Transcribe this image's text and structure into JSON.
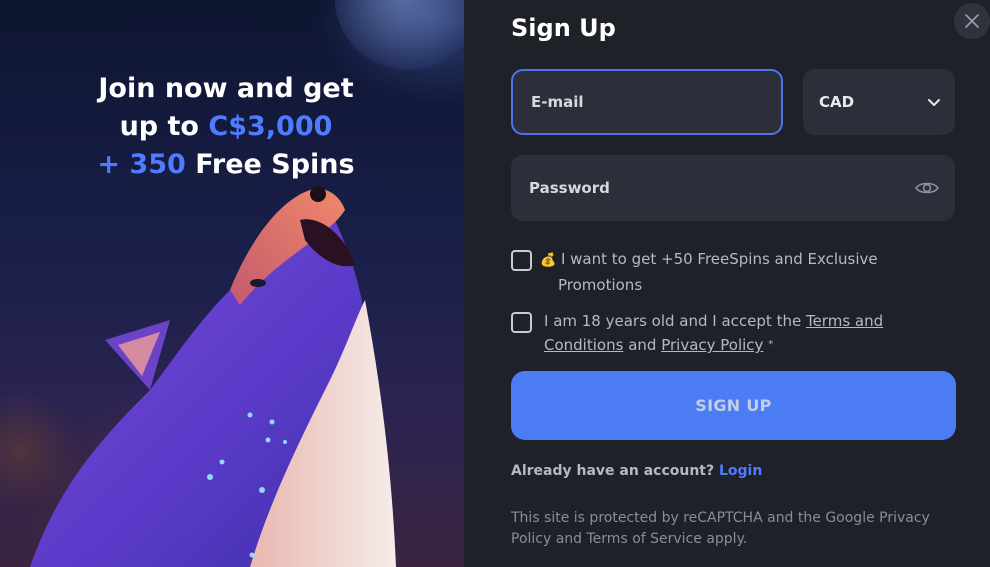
{
  "promo": {
    "headline_line1": "Join now and get",
    "headline_up_to": "up to",
    "headline_amount": "C$3,000",
    "headline_plus_spins": "+ 350",
    "headline_free_spins": "Free Spins",
    "accent_color": "#4f7bff"
  },
  "form": {
    "title": "Sign Up",
    "email_placeholder": "E-mail",
    "currency_value": "CAD",
    "password_placeholder": "Password",
    "promo_checkbox_emoji": "💰",
    "promo_checkbox_line1": "I want to get +50 FreeSpins and Exclusive",
    "promo_checkbox_line2": "Promotions",
    "terms_prefix": "I am 18 years old and I accept the",
    "terms_link": "Terms and Conditions",
    "terms_and": "and",
    "privacy_link": "Privacy Policy",
    "required_mark": "*",
    "submit_label": "SIGN UP",
    "login_prompt": "Already have an account?",
    "login_link": "Login",
    "recaptcha_text": "This site is protected by reCAPTCHA and the Google Privacy Policy and Terms of Service apply."
  },
  "icons": {
    "close": "close-icon",
    "chevron": "chevron-down-icon",
    "eye": "eye-icon"
  },
  "colors": {
    "button": "#4b7cf3",
    "field_bg": "#2c2f39",
    "focus_border": "#4a74f0"
  }
}
